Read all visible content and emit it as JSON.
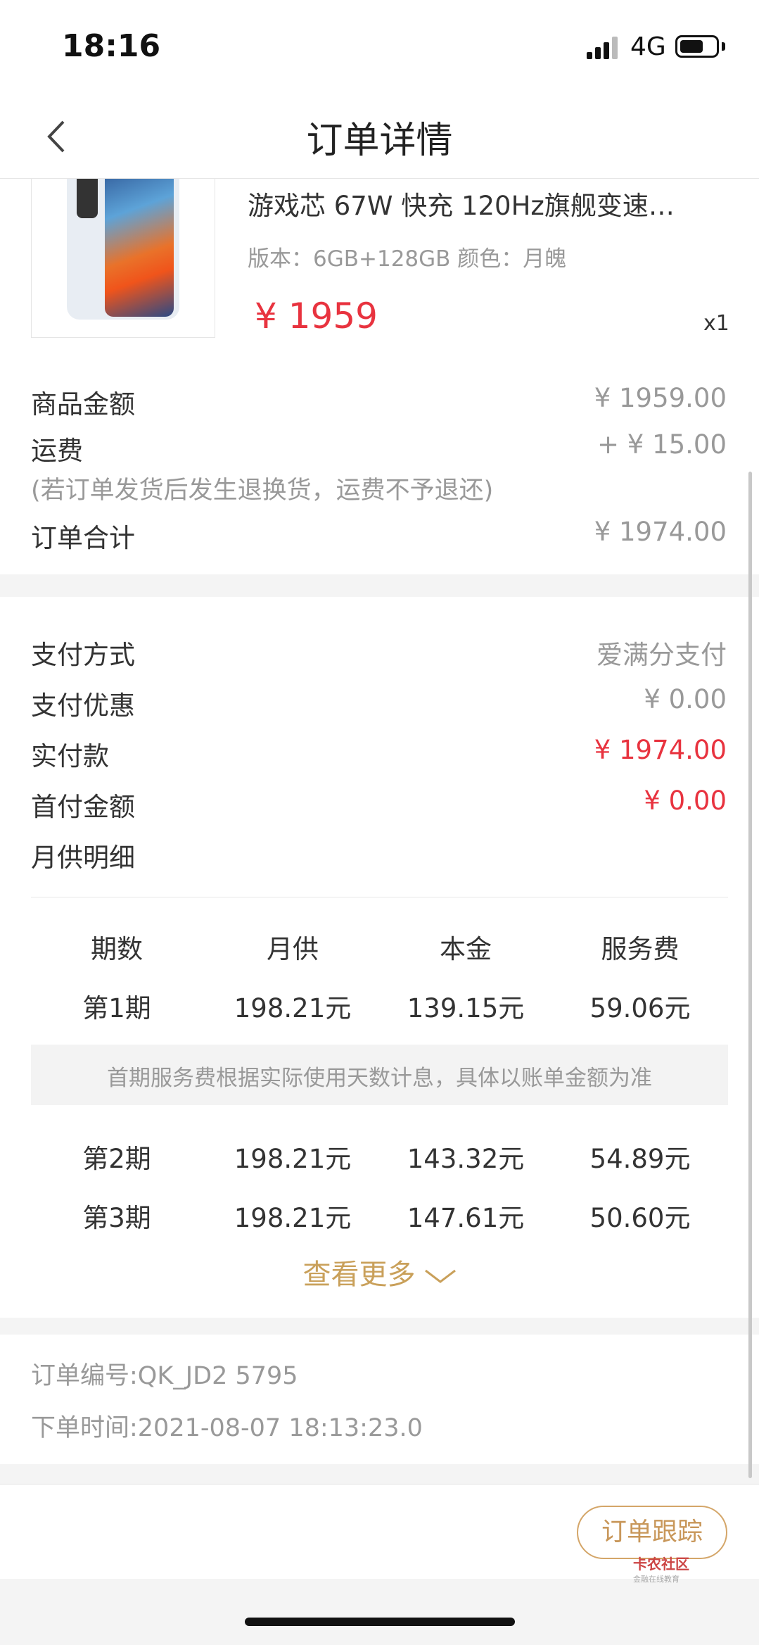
{
  "status_bar": {
    "time": "18:16",
    "network": "4G"
  },
  "nav": {
    "title": "订单详情"
  },
  "product": {
    "title": "游戏芯 67W 快充 120Hz旗舰变速…",
    "spec": "版本：6GB+128GB 颜色：月魄",
    "price": "¥ 1959",
    "quantity": "x1"
  },
  "amounts": {
    "goods_label": "商品金额",
    "goods_value": "¥ 1959.00",
    "shipping_label": "运费",
    "shipping_value": "+ ¥ 15.00",
    "shipping_note": "(若订单发货后发生退换货，运费不予退还)",
    "total_label": "订单合计",
    "total_value": "¥ 1974.00"
  },
  "payment": {
    "method_label": "支付方式",
    "method_value": "爱满分支付",
    "discount_label": "支付优惠",
    "discount_value": "¥ 0.00",
    "paid_label": "实付款",
    "paid_value": "¥ 1974.00",
    "down_label": "首付金额",
    "down_value": "¥ 0.00",
    "monthly_label": "月供明细"
  },
  "installments": {
    "headers": [
      "期数",
      "月供",
      "本金",
      "服务费"
    ],
    "rows": [
      [
        "第1期",
        "198.21元",
        "139.15元",
        "59.06元"
      ],
      [
        "第2期",
        "198.21元",
        "143.32元",
        "54.89元"
      ],
      [
        "第3期",
        "198.21元",
        "147.61元",
        "50.60元"
      ]
    ],
    "tip": "首期服务费根据实际使用天数计息，具体以账单金额为准",
    "more_label": "查看更多"
  },
  "order_info": {
    "number": "订单编号:QK_JD2   5795",
    "time": "下单时间:2021-08-07 18:13:23.0"
  },
  "bottom": {
    "track_label": "订单跟踪"
  },
  "watermark": {
    "title": "卡农社区",
    "subtitle": "金融在线教育"
  },
  "colors": {
    "accent_red": "#e8333f",
    "gold": "#c9a05a"
  }
}
